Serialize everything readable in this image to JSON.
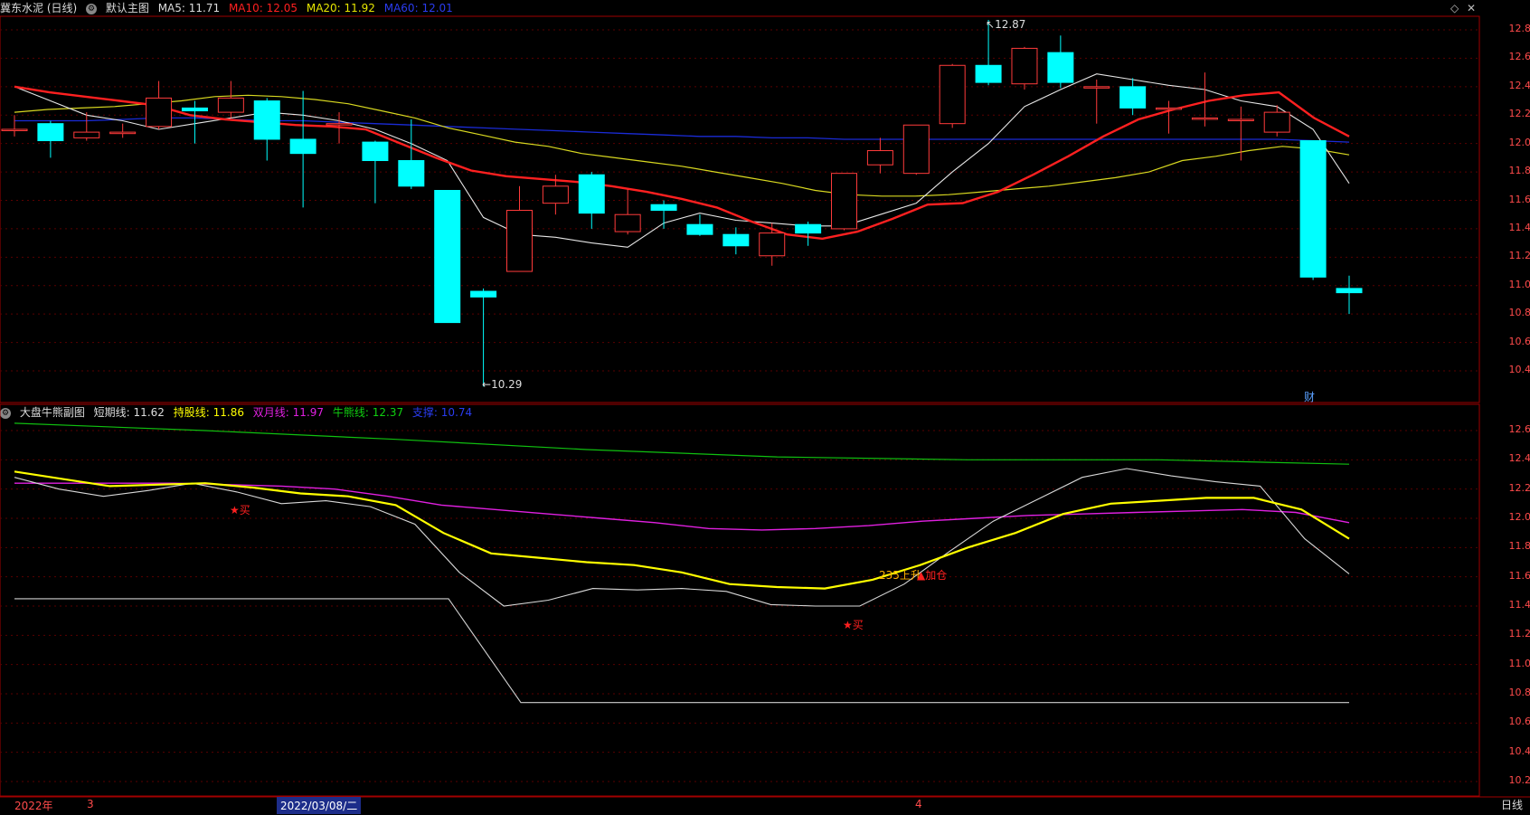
{
  "main_header": {
    "stock_title": "冀东水泥 (日线)",
    "chart_name": "默认主图",
    "ma5_label": "MA5:",
    "ma5_value": "11.71",
    "ma10_label": "MA10:",
    "ma10_value": "12.05",
    "ma20_label": "MA20:",
    "ma20_value": "11.92",
    "ma60_label": "MA60:",
    "ma60_value": "12.01"
  },
  "sub_header": {
    "chart_name": "大盘牛熊副图",
    "short_label": "短期线:",
    "short_value": "11.62",
    "hold_label": "持股线:",
    "hold_value": "11.86",
    "month_label": "双月线:",
    "month_value": "11.97",
    "bull_label": "牛熊线:",
    "bull_value": "12.37",
    "support_label": "支撑:",
    "support_value": "10.74"
  },
  "colors": {
    "up": "#ff3b3b",
    "down": "#00ffff",
    "ma5": "#e6e6e6",
    "ma10": "#ff2020",
    "ma20": "#d8d820",
    "ma60": "#1a2bd6",
    "hold": "#ffff00",
    "month": "#e020e0",
    "bull": "#10c010",
    "support": "#d0d0d0",
    "grid": "#5a0000",
    "border": "#a00000"
  },
  "main_axis": [
    "12.80",
    "12.60",
    "12.40",
    "12.20",
    "12.00",
    "11.80",
    "11.60",
    "11.40",
    "11.20",
    "11.00",
    "10.80",
    "10.60",
    "10.40"
  ],
  "sub_axis": [
    "12.60",
    "12.40",
    "12.20",
    "12.00",
    "11.80",
    "11.60",
    "11.40",
    "11.20",
    "11.00",
    "10.80",
    "10.60",
    "10.40",
    "10.20"
  ],
  "annotations": {
    "high": "12.87",
    "low": "10.29",
    "cai": "财",
    "buy1": "★买",
    "buy2": "★买",
    "rise": "235上升",
    "add": "▲加仓"
  },
  "bottom": {
    "year": "2022年",
    "m3": "3",
    "selected_date": "2022/03/08/二",
    "m4": "4",
    "period": "日线"
  },
  "chart_data": {
    "type": "candlestick",
    "candles": [
      {
        "o": 12.1,
        "c": 12.1,
        "h": 12.2,
        "l": 12.05
      },
      {
        "o": 12.14,
        "c": 12.02,
        "h": 12.16,
        "l": 11.9
      },
      {
        "o": 12.04,
        "c": 12.08,
        "h": 12.22,
        "l": 12.02
      },
      {
        "o": 12.07,
        "c": 12.08,
        "h": 12.14,
        "l": 12.04
      },
      {
        "o": 12.12,
        "c": 12.32,
        "h": 12.44,
        "l": 12.1
      },
      {
        "o": 12.25,
        "c": 12.23,
        "h": 12.3,
        "l": 12.0
      },
      {
        "o": 12.22,
        "c": 12.32,
        "h": 12.44,
        "l": 12.18
      },
      {
        "o": 12.3,
        "c": 12.03,
        "h": 12.32,
        "l": 11.88
      },
      {
        "o": 12.03,
        "c": 11.93,
        "h": 12.37,
        "l": 11.55
      },
      {
        "o": 12.14,
        "c": 12.14,
        "h": 12.22,
        "l": 12.0
      },
      {
        "o": 12.01,
        "c": 11.88,
        "h": 12.02,
        "l": 11.58
      },
      {
        "o": 11.88,
        "c": 11.7,
        "h": 12.17,
        "l": 11.68
      },
      {
        "o": 11.67,
        "c": 10.74,
        "h": 11.67,
        "l": 10.74
      },
      {
        "o": 10.96,
        "c": 10.92,
        "h": 10.98,
        "l": 10.29
      },
      {
        "o": 11.1,
        "c": 11.53,
        "h": 11.7,
        "l": 11.1
      },
      {
        "o": 11.58,
        "c": 11.7,
        "h": 11.78,
        "l": 11.5
      },
      {
        "o": 11.78,
        "c": 11.51,
        "h": 11.8,
        "l": 11.4
      },
      {
        "o": 11.38,
        "c": 11.5,
        "h": 11.68,
        "l": 11.36
      },
      {
        "o": 11.57,
        "c": 11.53,
        "h": 11.6,
        "l": 11.4
      },
      {
        "o": 11.43,
        "c": 11.36,
        "h": 11.5,
        "l": 11.35
      },
      {
        "o": 11.36,
        "c": 11.28,
        "h": 11.41,
        "l": 11.22
      },
      {
        "o": 11.21,
        "c": 11.37,
        "h": 11.44,
        "l": 11.14
      },
      {
        "o": 11.43,
        "c": 11.37,
        "h": 11.45,
        "l": 11.28
      },
      {
        "o": 11.4,
        "c": 11.79,
        "h": 11.79,
        "l": 11.39
      },
      {
        "o": 11.85,
        "c": 11.95,
        "h": 12.04,
        "l": 11.79
      },
      {
        "o": 11.79,
        "c": 12.13,
        "h": 12.13,
        "l": 11.78
      },
      {
        "o": 12.14,
        "c": 12.55,
        "h": 12.56,
        "l": 12.11
      },
      {
        "o": 12.55,
        "c": 12.43,
        "h": 12.87,
        "l": 12.41
      },
      {
        "o": 12.42,
        "c": 12.67,
        "h": 12.68,
        "l": 12.38
      },
      {
        "o": 12.64,
        "c": 12.43,
        "h": 12.76,
        "l": 12.39
      },
      {
        "o": 12.4,
        "c": 12.4,
        "h": 12.45,
        "l": 12.14
      },
      {
        "o": 12.4,
        "c": 12.25,
        "h": 12.46,
        "l": 12.2
      },
      {
        "o": 12.25,
        "c": 12.25,
        "h": 12.3,
        "l": 12.07
      },
      {
        "o": 12.18,
        "c": 12.18,
        "h": 12.5,
        "l": 12.12
      },
      {
        "o": 12.17,
        "c": 12.17,
        "h": 12.26,
        "l": 11.88
      },
      {
        "o": 12.08,
        "c": 12.22,
        "h": 12.27,
        "l": 12.05
      },
      {
        "o": 12.02,
        "c": 11.06,
        "h": 12.02,
        "l": 11.04
      },
      {
        "o": 10.98,
        "c": 10.95,
        "h": 11.07,
        "l": 10.8
      }
    ],
    "ma5": [
      12.4,
      12.3,
      12.2,
      12.16,
      12.1,
      12.14,
      12.18,
      12.22,
      12.2,
      12.16,
      12.1,
      12.0,
      11.88,
      11.48,
      11.36,
      11.34,
      11.3,
      11.27,
      11.44,
      11.51,
      11.46,
      11.44,
      11.42,
      11.42,
      11.5,
      11.58,
      11.8,
      12.0,
      12.26,
      12.38,
      12.49,
      12.45,
      12.41,
      12.38,
      12.3,
      12.26,
      12.1,
      11.72
    ],
    "ma10": [
      12.4,
      12.36,
      12.33,
      12.3,
      12.27,
      12.2,
      12.17,
      12.15,
      12.13,
      12.12,
      12.1,
      12.0,
      11.9,
      11.81,
      11.77,
      11.75,
      11.73,
      11.7,
      11.66,
      11.61,
      11.55,
      11.45,
      11.36,
      11.33,
      11.38,
      11.47,
      11.57,
      11.58,
      11.66,
      11.78,
      11.91,
      12.05,
      12.17,
      12.24,
      12.3,
      12.34,
      12.36,
      12.18,
      12.05
    ],
    "ma20": [
      12.22,
      12.24,
      12.25,
      12.26,
      12.28,
      12.3,
      12.33,
      12.34,
      12.33,
      12.31,
      12.28,
      12.23,
      12.18,
      12.11,
      12.06,
      12.01,
      11.98,
      11.93,
      11.9,
      11.87,
      11.84,
      11.8,
      11.76,
      11.72,
      11.67,
      11.64,
      11.63,
      11.63,
      11.64,
      11.66,
      11.68,
      11.7,
      11.73,
      11.76,
      11.8,
      11.88,
      11.91,
      11.95,
      11.98,
      11.96,
      11.92
    ],
    "ma60": [
      12.16,
      12.16,
      12.16,
      12.17,
      12.18,
      12.18,
      12.17,
      12.16,
      12.16,
      12.15,
      12.14,
      12.13,
      12.12,
      12.11,
      12.1,
      12.09,
      12.08,
      12.07,
      12.06,
      12.05,
      12.05,
      12.04,
      12.04,
      12.03,
      12.03,
      12.03,
      12.03,
      12.03,
      12.03,
      12.03,
      12.03,
      12.03,
      12.03,
      12.03,
      12.03,
      12.03,
      12.02,
      12.01
    ],
    "sub_short": [
      12.28,
      12.2,
      12.15,
      12.19,
      12.24,
      12.18,
      12.1,
      12.12,
      12.08,
      11.96,
      11.63,
      11.4,
      11.44,
      11.52,
      11.51,
      11.52,
      11.5,
      11.41,
      11.4,
      11.4,
      11.55,
      11.77,
      11.98,
      12.13,
      12.28,
      12.34,
      12.29,
      12.25,
      12.22,
      11.86,
      11.62
    ],
    "sub_hold": [
      12.32,
      12.27,
      12.22,
      12.23,
      12.24,
      12.21,
      12.17,
      12.15,
      12.09,
      11.9,
      11.76,
      11.73,
      11.7,
      11.68,
      11.63,
      11.55,
      11.53,
      11.52,
      11.58,
      11.68,
      11.8,
      11.9,
      12.03,
      12.1,
      12.12,
      12.14,
      12.14,
      12.06,
      11.86
    ],
    "sub_month": [
      12.24,
      12.24,
      12.24,
      12.24,
      12.23,
      12.22,
      12.2,
      12.15,
      12.09,
      12.06,
      12.03,
      12.0,
      11.97,
      11.93,
      11.92,
      11.93,
      11.95,
      11.98,
      12.0,
      12.02,
      12.03,
      12.04,
      12.05,
      12.06,
      12.04,
      11.97
    ],
    "sub_bull": [
      12.65,
      12.6,
      12.54,
      12.47,
      12.42,
      12.4,
      12.4,
      12.37
    ],
    "sub_support": [
      11.45,
      11.45,
      10.74,
      10.74
    ],
    "main_range": [
      10.3,
      12.9
    ],
    "sub_range": [
      10.2,
      12.75
    ]
  }
}
